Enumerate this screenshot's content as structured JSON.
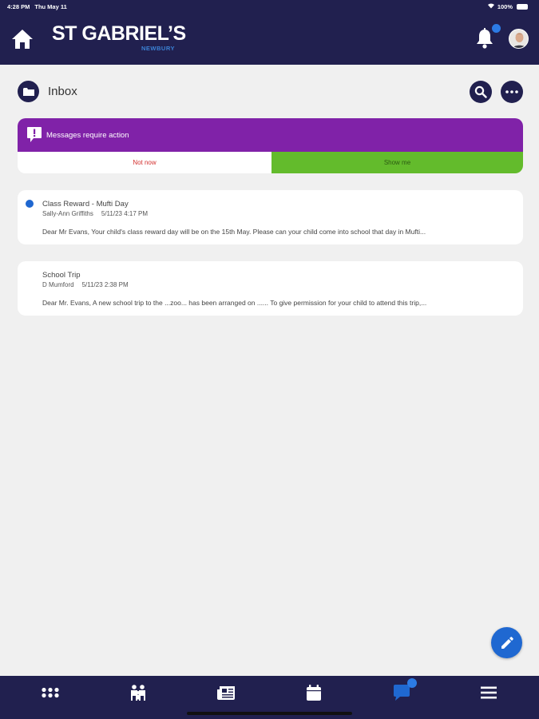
{
  "status_bar": {
    "time": "4:28 PM",
    "date": "Thu May 11",
    "battery": "100%"
  },
  "header": {
    "logo_main": "ST GABRIEL’S",
    "logo_sub": "NEWBURY"
  },
  "inbox": {
    "title": "Inbox"
  },
  "action_banner": {
    "message": "Messages require action",
    "not_now_label": "Not now",
    "show_me_label": "Show me"
  },
  "messages": [
    {
      "subject": "Class Reward - Mufti Day",
      "sender": "Sally-Ann Griffiths",
      "timestamp": "5/11/23 4:17 PM",
      "preview": "Dear Mr Evans, Your child's class reward day will be on the 15th May. Please can your child come into school that day in Mufti...",
      "unread": true
    },
    {
      "subject": "School Trip",
      "sender": "D Mumford",
      "timestamp": "5/11/23 2:38 PM",
      "preview": "Dear Mr. Evans, A new school trip to the ...zoo... has been arranged on ...... To give permission for your child to attend this trip,...",
      "unread": false
    }
  ],
  "colors": {
    "navy": "#21204f",
    "purple": "#8022a8",
    "green": "#63bb2c",
    "blue": "#1f68d1",
    "red": "#d3302f"
  },
  "icons": {
    "home": "home-icon",
    "bell": "bell-icon",
    "folder": "folder-icon",
    "search": "search-icon",
    "more": "more-icon",
    "alert": "alert-icon",
    "compose": "pencil-icon",
    "nav": [
      "grid-icon",
      "family-icon",
      "newspaper-icon",
      "calendar-icon",
      "chat-icon",
      "menu-icon"
    ]
  }
}
